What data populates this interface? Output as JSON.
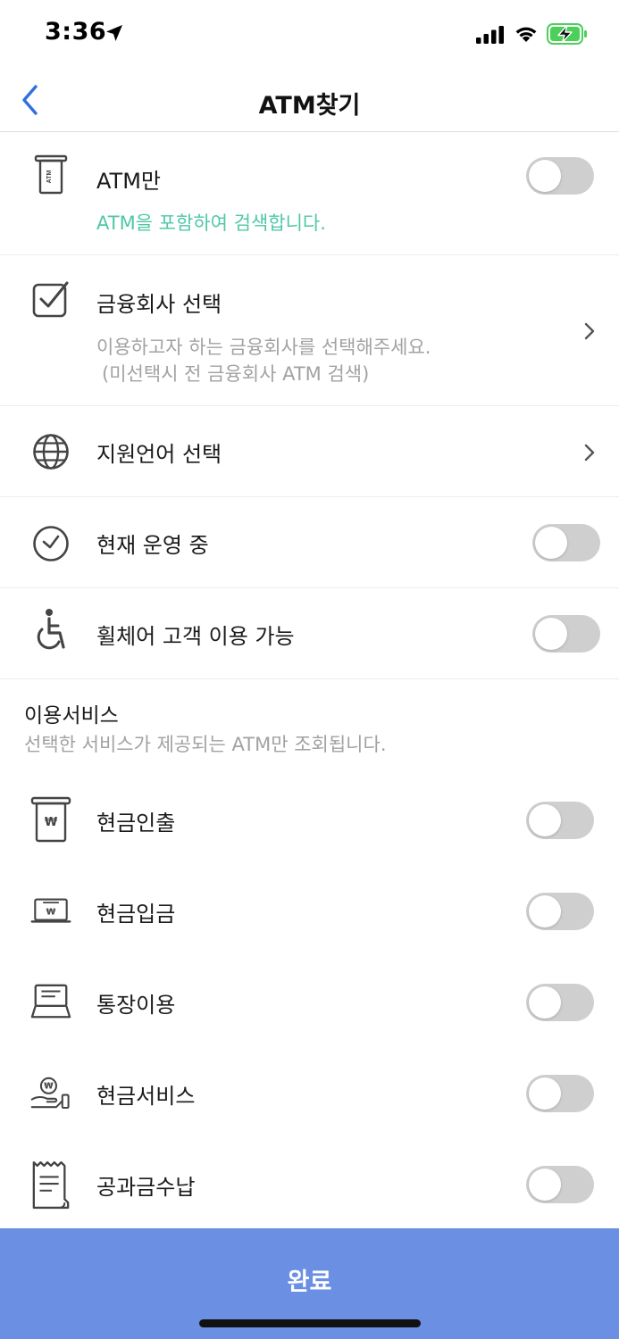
{
  "status_bar": {
    "time": "3:36"
  },
  "header": {
    "title": "ATM찾기"
  },
  "filters": {
    "atm_only": {
      "title": "ATM만",
      "subtitle": "ATM을 포함하여 검색합니다.",
      "enabled": false
    },
    "institution": {
      "title": "금융회사 선택",
      "subtitle_line1": "이용하고자 하는 금융회사를 선택해주세요.",
      "subtitle_line2": "(미선택시 전 금융회사 ATM 검색)"
    },
    "language": {
      "title": "지원언어 선택"
    },
    "open_now": {
      "title": "현재 운영 중",
      "enabled": false
    },
    "wheelchair": {
      "title": "휠체어 고객 이용 가능",
      "enabled": false
    }
  },
  "services": {
    "heading": "이용서비스",
    "description": "선택한 서비스가 제공되는 ATM만 조회됩니다.",
    "items": [
      {
        "label": "현금인출",
        "icon": "cash-withdrawal-icon",
        "enabled": false
      },
      {
        "label": "현금입금",
        "icon": "cash-deposit-icon",
        "enabled": false
      },
      {
        "label": "통장이용",
        "icon": "passbook-icon",
        "enabled": false
      },
      {
        "label": "현금서비스",
        "icon": "cash-service-icon",
        "enabled": false
      },
      {
        "label": "공과금수납",
        "icon": "bill-payment-icon",
        "enabled": false
      }
    ]
  },
  "footer": {
    "done_label": "완료"
  },
  "colors": {
    "accent_green": "#4fc8a6",
    "primary_button": "#6a8fe3",
    "back_arrow": "#2f6fe0",
    "toggle_off": "#cfcfcf"
  }
}
